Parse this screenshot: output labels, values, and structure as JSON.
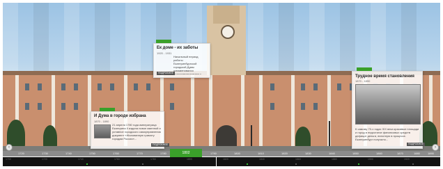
{
  "cards": [
    {
      "title": "Ек доме - их заботы",
      "years": "1920 - 1931",
      "text": "Начальный период работы Екатеринбургской городской Думы ознаменовался подготовительными к неоднократным перерывам деятельности. Городское самоуправление 1920...",
      "more": "ПОДРОБНЕЕ"
    },
    {
      "title": "И Дума в городе избрана",
      "years": "1870 - 1890",
      "text": "21 апреля 1780 года императрица Екатерина II издала новое именной и уставное городского самоуправления документ «Жалованную грамоту городам России»...",
      "more": "ПОДРОБНЕЕ"
    },
    {
      "title": "Трудное время становления",
      "years": "1870 - 1890",
      "text": "К самому 70-х годах XIX века красивые площади и город в недостатке финансовых средств дефицит деньги, вплотную в процессе. Екатеринбург получило...",
      "more": "ПОДРОБНЕЕ"
    }
  ],
  "timeline": {
    "years": [
      "1720",
      "1730",
      "1740",
      "1750",
      "1760",
      "1770",
      "1780",
      "1790",
      "1800",
      "1810",
      "1820",
      "1830",
      "1840",
      "1850",
      "1860",
      "1870",
      "1880",
      "1890"
    ],
    "active_year": "1802",
    "prev_arrow": "‹",
    "next_arrow": "›"
  },
  "track": {
    "labels": [
      "1700",
      "1720",
      "1740",
      "1760",
      "1780",
      "1800",
      "1820",
      "1840",
      "1860",
      "1880",
      "1900",
      "1920"
    ]
  },
  "colors": {
    "accent": "#3aa02a",
    "timeline_bg": "#8c8c8c",
    "track_bg": "#121212"
  }
}
